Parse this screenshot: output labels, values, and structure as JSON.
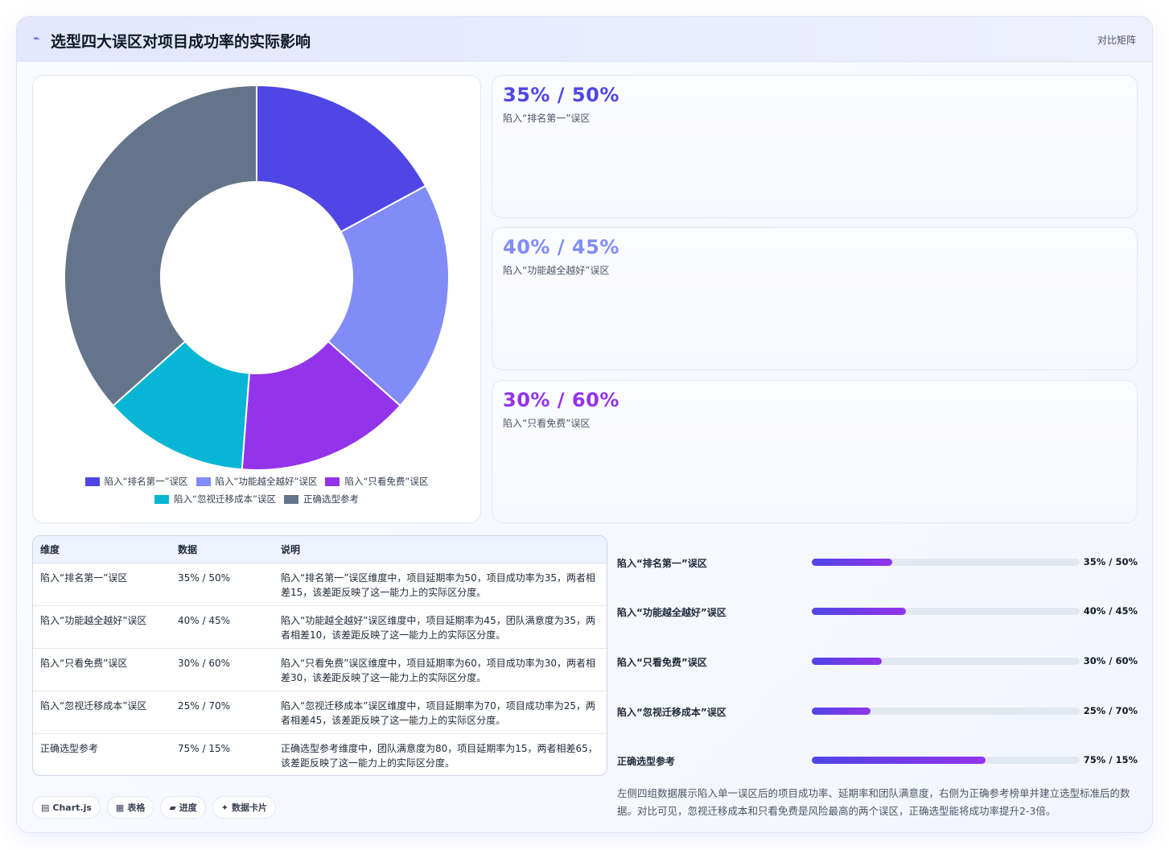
{
  "header": {
    "icon": "chart-line-icon",
    "title": "选型四大误区对项目成功率的实际影响",
    "mode_label": "对比矩阵"
  },
  "colors": {
    "s1": "#4f46e5",
    "s2": "#818cf8",
    "s3": "#9333ea",
    "s4": "#06b6d4",
    "s5": "#64748b"
  },
  "chart_data": {
    "type": "pie",
    "donut": true,
    "categories": [
      "陷入“排名第一”误区",
      "陷入“功能越全越好”误区",
      "陷入“只看免费”误区",
      "陷入“忽视迁移成本”误区",
      "正确选型参考"
    ],
    "values": [
      35,
      40,
      30,
      25,
      75
    ],
    "colors": [
      "#4f46e5",
      "#818cf8",
      "#9333ea",
      "#06b6d4",
      "#64748b"
    ],
    "legend_position": "bottom"
  },
  "stats": [
    {
      "value": "35% / 50%",
      "label": "陷入“排名第一”误区",
      "color": "#4f46e5"
    },
    {
      "value": "40% / 45%",
      "label": "陷入“功能越全越好”误区",
      "color": "#818cf8"
    },
    {
      "value": "30% / 60%",
      "label": "陷入“只看免费”误区",
      "color": "#9333ea"
    }
  ],
  "table": {
    "headers": [
      "维度",
      "数据",
      "说明"
    ],
    "rows": [
      [
        "陷入“排名第一”误区",
        "35% / 50%",
        "陷入“排名第一”误区维度中，项目延期率为50，项目成功率为35，两者相差15，该差距反映了这一能力上的实际区分度。"
      ],
      [
        "陷入“功能越全越好”误区",
        "40% / 45%",
        "陷入“功能越全越好”误区维度中，项目延期率为45，团队满意度为35，两者相差10，该差距反映了这一能力上的实际区分度。"
      ],
      [
        "陷入“只看免费”误区",
        "30% / 60%",
        "陷入“只看免费”误区维度中，项目延期率为60，项目成功率为30，两者相差30，该差距反映了这一能力上的实际区分度。"
      ],
      [
        "陷入“忽视迁移成本”误区",
        "25% / 70%",
        "陷入“忽视迁移成本”误区维度中，项目延期率为70，项目成功率为25，两者相差45，该差距反映了这一能力上的实际区分度。"
      ],
      [
        "正确选型参考",
        "75% / 15%",
        "正确选型参考维度中，团队满意度为80，项目延期率为15，两者相差65，该差距反映了这一能力上的实际区分度。"
      ]
    ]
  },
  "progress": [
    {
      "label": "陷入“排名第一”误区",
      "value": "35% / 50%",
      "fill": 0.3
    },
    {
      "label": "陷入“功能越全越好”误区",
      "value": "40% / 45%",
      "fill": 0.35
    },
    {
      "label": "陷入“只看免费”误区",
      "value": "30% / 60%",
      "fill": 0.26
    },
    {
      "label": "陷入“忽视迁移成本”误区",
      "value": "25% / 70%",
      "fill": 0.22
    },
    {
      "label": "正确选型参考",
      "value": "75% / 15%",
      "fill": 0.65
    }
  ],
  "summary": "左侧四组数据展示陷入单一误区后的项目成功率、延期率和团队满意度，右侧为正确参考榜单并建立选型标准后的数据。对比可见，忽视迁移成本和只看免费是风险最高的两个误区，正确选型能将成功率提升2-3倍。",
  "chips": [
    {
      "icon": "chart-icon",
      "glyph": "▤",
      "label": "Chart.js"
    },
    {
      "icon": "table-icon",
      "glyph": "▦",
      "label": "表格"
    },
    {
      "icon": "progress-icon",
      "glyph": "▰",
      "label": "进度"
    },
    {
      "icon": "card-icon",
      "glyph": "✦",
      "label": "数据卡片"
    }
  ]
}
